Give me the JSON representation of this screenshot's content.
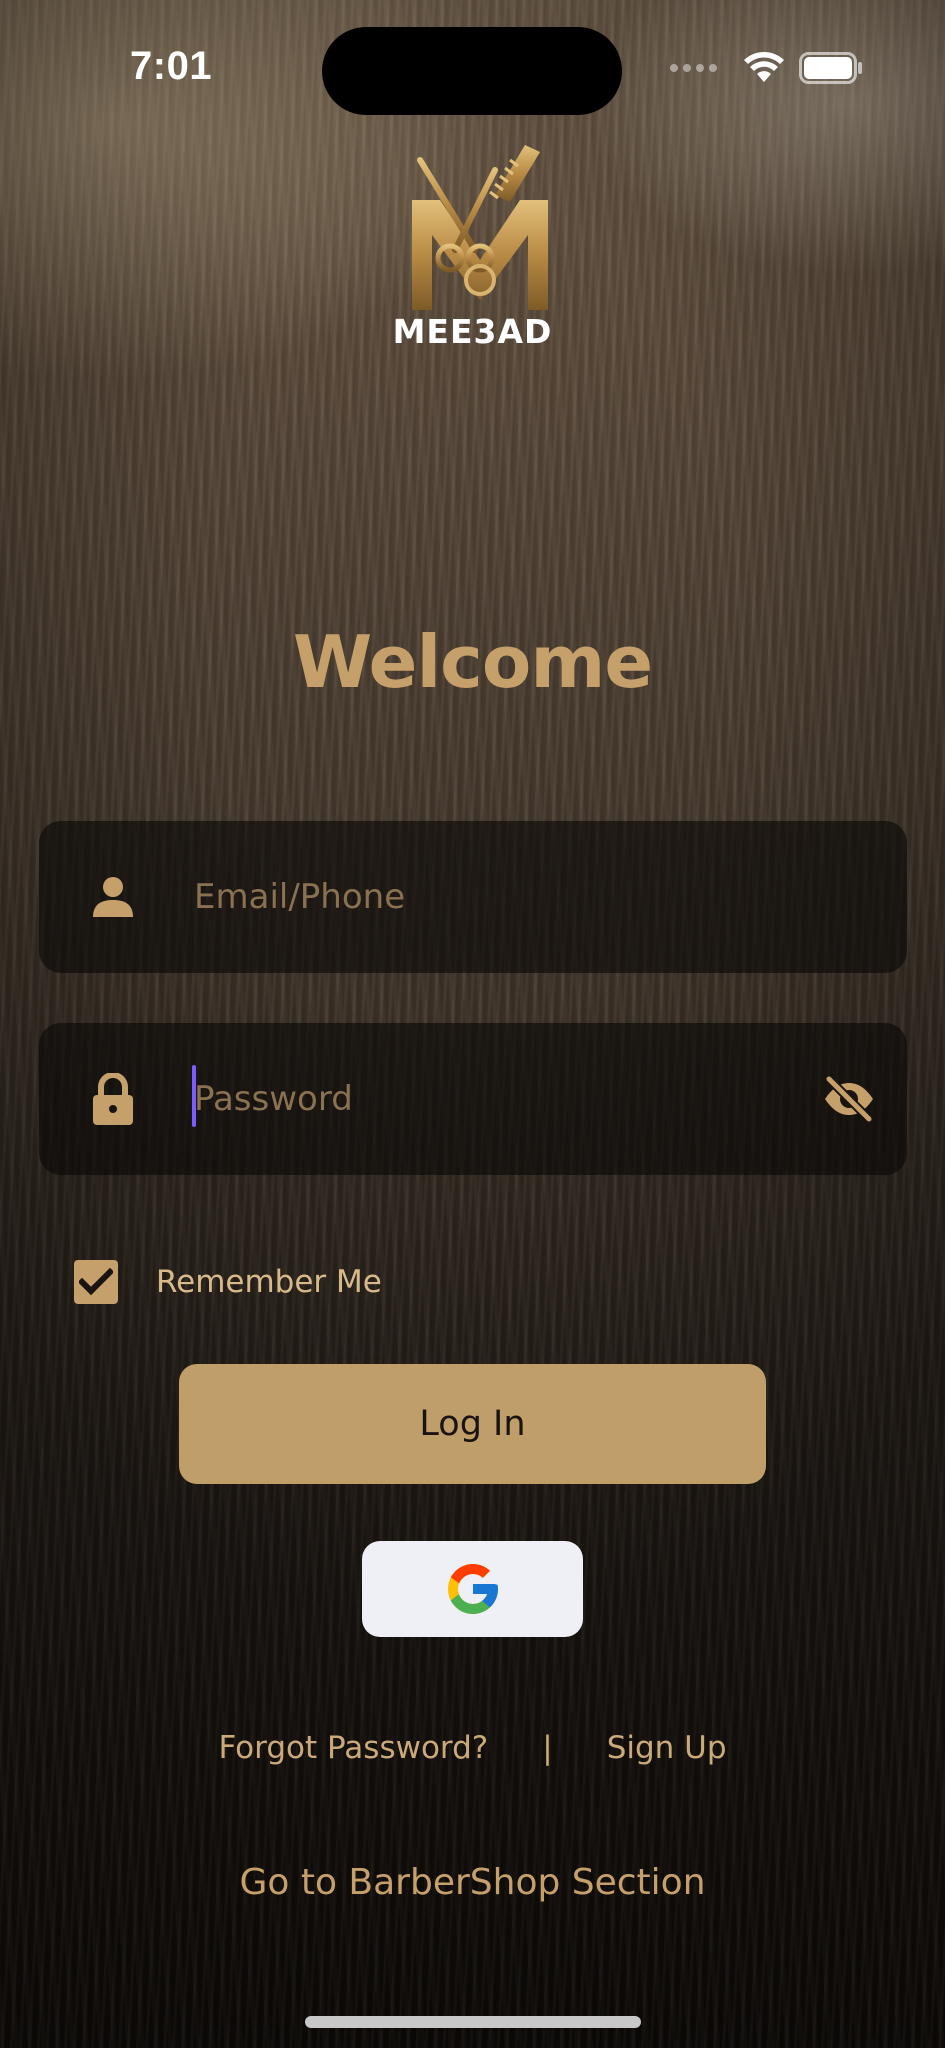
{
  "status_bar": {
    "time": "7:01"
  },
  "brand": {
    "name": "MEE3AD"
  },
  "heading": "Welcome",
  "email_field": {
    "placeholder": "Email/Phone",
    "icon": "person-icon"
  },
  "password_field": {
    "placeholder": "Password",
    "icon": "lock-icon",
    "toggle_icon": "eye-slash-icon"
  },
  "remember": {
    "label": "Remember Me",
    "checked": true
  },
  "login_button": {
    "label": "Log In"
  },
  "google_button": {
    "icon": "google-icon"
  },
  "links": {
    "forgot": "Forgot Password?",
    "separator": "|",
    "signup": "Sign Up"
  },
  "barbershop_link": "Go to BarberShop Section",
  "colors": {
    "accent": "#c6a06a",
    "button": "#c09e6a",
    "field_bg": "#0a0806"
  }
}
